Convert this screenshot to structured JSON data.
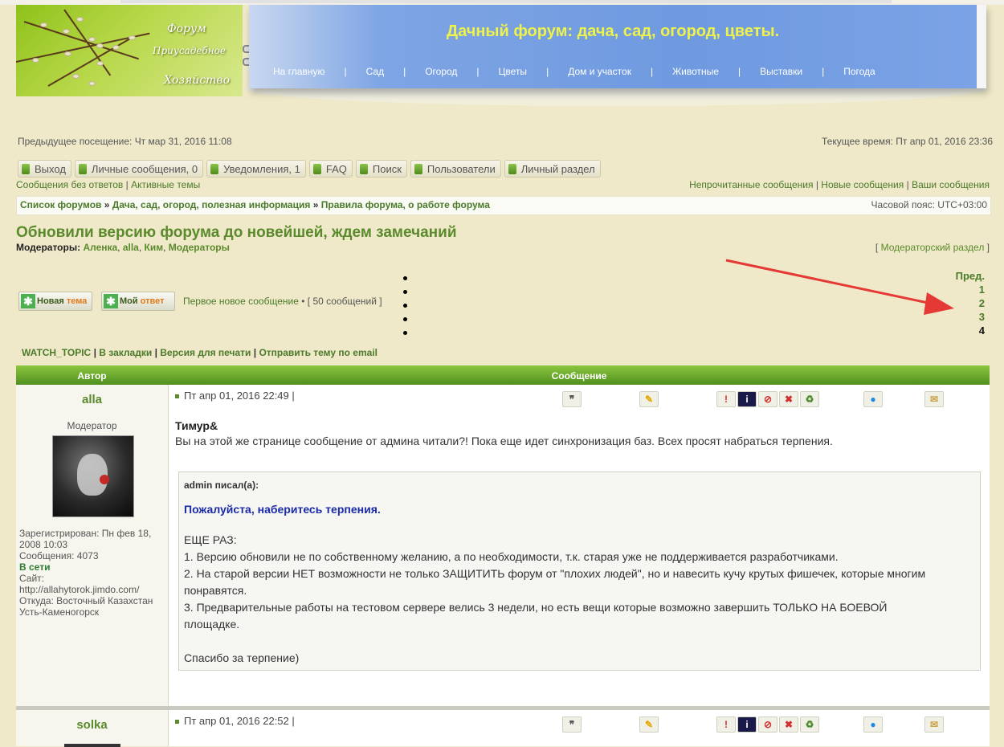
{
  "logo": {
    "line1": "Форум",
    "line2": "Приусадебное",
    "line3": "Хозяйство"
  },
  "site_title": "Дачный форум: дача, сад, огород, цветы.",
  "nav": [
    "На главную",
    "Сад",
    "Огород",
    "Цветы",
    "Дом и участок",
    "Животные",
    "Выставки",
    "Погода"
  ],
  "nav_sep": "|",
  "prev_visit": "Предыдущее посещение: Чт мар 31, 2016 11:08",
  "current_time": "Текущее время: Пт апр 01, 2016 23:36",
  "toolbar": [
    "Выход",
    "Личные сообщения, 0",
    "Уведомления, 1",
    "FAQ",
    "Поиск",
    "Пользователи",
    "Личный раздел"
  ],
  "links_left": [
    "Сообщения без ответов",
    "Активные темы"
  ],
  "links_right": [
    "Непрочитанные сообщения",
    "Новые сообщения",
    "Ваши сообщения"
  ],
  "link_sep": "|",
  "breadcrumb": [
    "Список форумов",
    "Дача, сад, огород, полезная информация",
    "Правила форума, о работе форума"
  ],
  "breadcrumb_sep": "»",
  "timezone": "Часовой пояс: UTC+03:00",
  "topic_title": "Обновили версию форума до новейшей, ждем замечаний",
  "moderators_label": "Модераторы:",
  "moderators": [
    "Аленка",
    "alla",
    "Ким",
    "Модераторы"
  ],
  "moderator_section": "Модераторский раздел",
  "buttons": {
    "new_topic_a": "Новая",
    "new_topic_b": "тема",
    "reply_a": "Мой",
    "reply_b": "ответ"
  },
  "first_new": "Первое новое сообщение",
  "post_count": "[ 50 сообщений ]",
  "pager": {
    "prev": "Пред.",
    "pages": [
      "1",
      "2",
      "3"
    ],
    "current": "4"
  },
  "topic_tools": [
    "WATCH_TOPIC",
    "В закладки",
    "Версия для печати",
    "Отправить тему по email"
  ],
  "table": {
    "author_header": "Автор",
    "message_header": "Сообщение"
  },
  "post1": {
    "author": "alla",
    "rank": "Модератор",
    "registered": "Зарегистрирован: Пн фев 18, 2008 10:03",
    "messages": "Сообщения: 4073",
    "online": "В сети",
    "site_label": "Сайт:",
    "site_url": "http://allahytorok.jimdo.com/",
    "from": "Откуда: Восточный Казахстан Усть-Каменогорск",
    "date": "Пт апр 01, 2016 22:49 |",
    "greeting": "Тимур&",
    "text": "Вы на этой же странице сообщение от админа читали?! Пока еще идет синхронизация баз. Всех просят набраться терпения.",
    "quote": {
      "header": "admin писал(а):",
      "bold": "Пожалуйста, наберитесь терпения.",
      "line1": "ЕЩЕ РАЗ:",
      "line2": "1. Версию обновили не по собственному желанию, а по необходимости, т.к. старая уже не поддерживается разработчиками.",
      "line3a": "2. На старой версии НЕТ возможности не только ЗАЩИТИТЬ форум от \"плохих людей\", но и навесить кучу крутых фишечек, которые многим",
      "line3b": "понравятся.",
      "line4a": "3. Предварительные работы на тестовом сервере велись 3 недели, но есть вещи которые возможно завершить ТОЛЬКО НА БОЕВОЙ",
      "line4b": "площадке.",
      "thanks": "Спасибо за терпение)"
    }
  },
  "post2": {
    "author": "solka",
    "date": "Пт апр 01, 2016 22:52 |"
  },
  "post_icons": [
    "quote-icon",
    "edit-icon",
    "report-icon",
    "info-icon",
    "warn-icon",
    "delete-icon",
    "ban-icon",
    "pm-icon",
    "email-icon"
  ]
}
